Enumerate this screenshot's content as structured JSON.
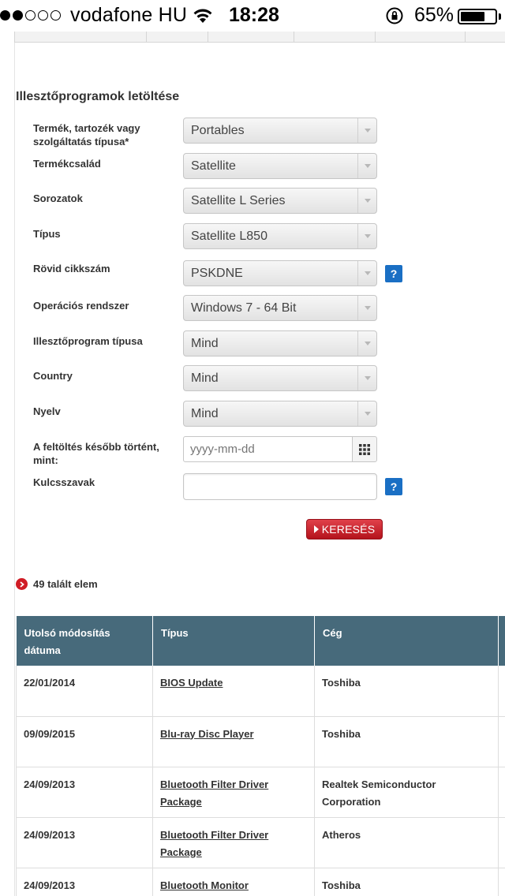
{
  "status_bar": {
    "carrier": "vodafone HU",
    "time": "18:28",
    "battery": "65%",
    "battery_level": 0.65,
    "signal_bars_filled": 2,
    "signal_bars_total": 5
  },
  "section_title": "Illesztőprogramok letöltése",
  "form": {
    "product_type": {
      "label": "Termék, tartozék vagy szolgáltatás típusa*",
      "value": "Portables"
    },
    "product_family": {
      "label": "Termékcsalád",
      "value": "Satellite"
    },
    "series": {
      "label": "Sorozatok",
      "value": "Satellite L Series"
    },
    "model": {
      "label": "Típus",
      "value": "Satellite L850"
    },
    "part_number": {
      "label": "Rövid cikkszám",
      "value": "PSKDNE",
      "help": "?"
    },
    "os": {
      "label": "Operációs rendszer",
      "value": "Windows 7 - 64 Bit"
    },
    "driver_type": {
      "label": "Illesztőprogram típusa",
      "value": "Mind"
    },
    "country": {
      "label": "Country",
      "value": "Mind"
    },
    "language": {
      "label": "Nyelv",
      "value": "Mind"
    },
    "upload_date": {
      "label": "A feltöltés később történt, mint:",
      "placeholder": "yyyy-mm-dd"
    },
    "keywords": {
      "label": "Kulcsszavak",
      "value": "",
      "help": "?"
    },
    "search_button": "KERESÉS"
  },
  "results_count": "49 talált elem",
  "table": {
    "headers": [
      "Utolsó módosítás dátuma",
      "Típus",
      "Cég"
    ],
    "rows": [
      {
        "date": "22/01/2014",
        "type": "BIOS Update",
        "company": "Toshiba"
      },
      {
        "date": "09/09/2015",
        "type": "Blu-ray Disc Player",
        "company": "Toshiba"
      },
      {
        "date": "24/09/2013",
        "type": "Bluetooth Filter Driver Package",
        "company": "Realtek Semiconductor Corporation"
      },
      {
        "date": "24/09/2013",
        "type": "Bluetooth Filter Driver Package",
        "company": "Atheros"
      },
      {
        "date": "24/09/2013",
        "type": "Bluetooth Monitor",
        "company": "Toshiba"
      }
    ]
  },
  "colors": {
    "table_header": "#476a7b",
    "search_button": "#c41a24",
    "help_icon": "#1a6fc4"
  }
}
